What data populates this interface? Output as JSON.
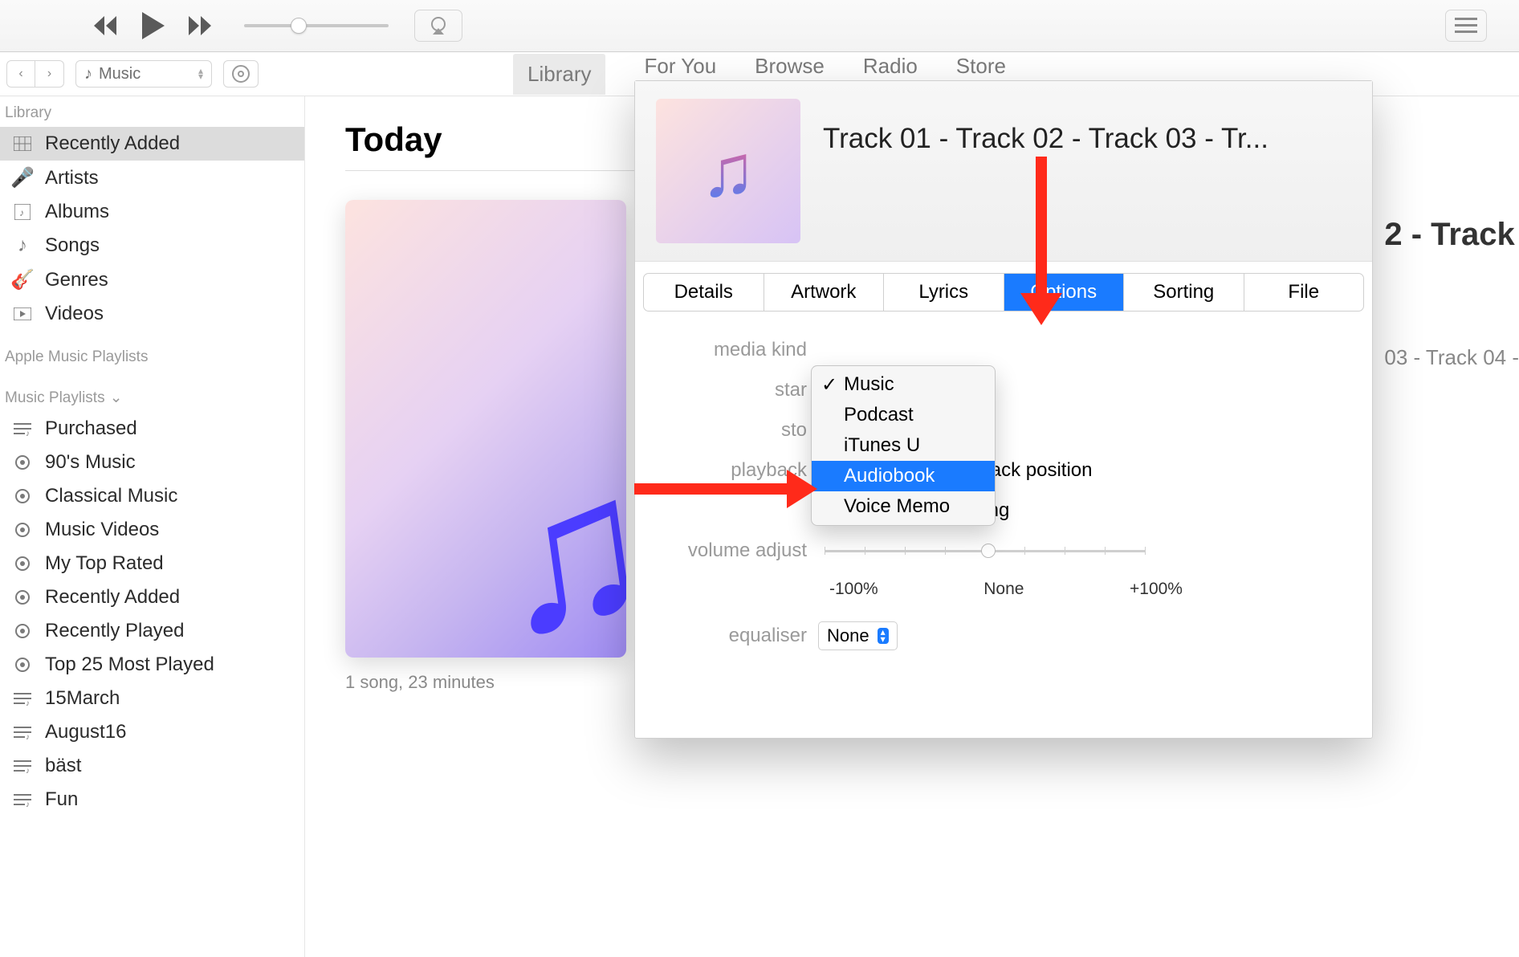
{
  "toolbar": {
    "apple_logo": ""
  },
  "subbar": {
    "media_selector": "Music",
    "tabs": [
      "Library",
      "For You",
      "Browse",
      "Radio",
      "Store"
    ],
    "active_tab": "Library"
  },
  "sidebar": {
    "library_header": "Library",
    "items": [
      {
        "label": "Recently Added",
        "icon": "grid-icon",
        "selected": true
      },
      {
        "label": "Artists",
        "icon": "mic-icon"
      },
      {
        "label": "Albums",
        "icon": "album-icon"
      },
      {
        "label": "Songs",
        "icon": "note-icon"
      },
      {
        "label": "Genres",
        "icon": "guitar-icon"
      },
      {
        "label": "Videos",
        "icon": "video-icon"
      }
    ],
    "apple_playlists_header": "Apple Music Playlists",
    "music_playlists_header": "Music Playlists",
    "playlists": [
      {
        "label": "Purchased",
        "icon": "playlist-icon"
      },
      {
        "label": "90's Music",
        "icon": "gear-icon"
      },
      {
        "label": "Classical Music",
        "icon": "gear-icon"
      },
      {
        "label": "Music Videos",
        "icon": "gear-icon"
      },
      {
        "label": "My Top Rated",
        "icon": "gear-icon"
      },
      {
        "label": "Recently Added",
        "icon": "gear-icon"
      },
      {
        "label": "Recently Played",
        "icon": "gear-icon"
      },
      {
        "label": "Top 25 Most Played",
        "icon": "gear-icon"
      },
      {
        "label": "15March",
        "icon": "playlist-icon"
      },
      {
        "label": "August16",
        "icon": "playlist-icon"
      },
      {
        "label": "bäst",
        "icon": "playlist-icon"
      },
      {
        "label": "Fun",
        "icon": "playlist-icon"
      }
    ]
  },
  "main": {
    "heading": "Today",
    "album_count": "1 song, 23 minutes",
    "right_title": "2 - Track",
    "right_row": "03 - Track 04 -"
  },
  "modal": {
    "title": "Track 01 - Track 02 - Track 03 - Tr...",
    "tabs": [
      "Details",
      "Artwork",
      "Lyrics",
      "Options",
      "Sorting",
      "File"
    ],
    "active_tab": "Options",
    "labels": {
      "media_kind": "media kind",
      "start": "star",
      "stop": "sto",
      "playback": "playback",
      "volume_adjust": "volume adjust",
      "equaliser": "equaliser"
    },
    "checkbox_remember": "Remember playback position",
    "checkbox_skip": "Skip when shuffling",
    "slider": {
      "left": "-100%",
      "mid": "None",
      "right": "+100%"
    },
    "equaliser_value": "None",
    "media_kind_options": [
      "Music",
      "Podcast",
      "iTunes U",
      "Audiobook",
      "Voice Memo"
    ],
    "media_kind_checked": "Music",
    "media_kind_highlight": "Audiobook"
  }
}
